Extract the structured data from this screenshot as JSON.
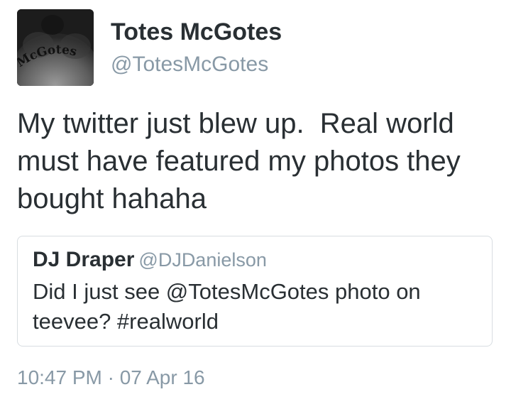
{
  "tweet": {
    "author": {
      "display_name": "Totes McGotes",
      "handle": "@TotesMcGotes",
      "avatar_tattoo_text": "McGotes"
    },
    "text": "My twitter just blew up.  Real world must have featured my photos they bought hahaha",
    "quoted_tweet": {
      "display_name": "DJ Draper",
      "handle": "@DJDanielson",
      "text": "Did I just see @TotesMcGotes photo on teevee? #realworld"
    },
    "timestamp": "10:47 PM · 07 Apr 16"
  },
  "colors": {
    "text_primary": "#292f33",
    "text_secondary": "#8899a6",
    "card_border": "#d8dde1",
    "background": "#ffffff"
  },
  "icons": {
    "avatar": "profile-photo"
  }
}
